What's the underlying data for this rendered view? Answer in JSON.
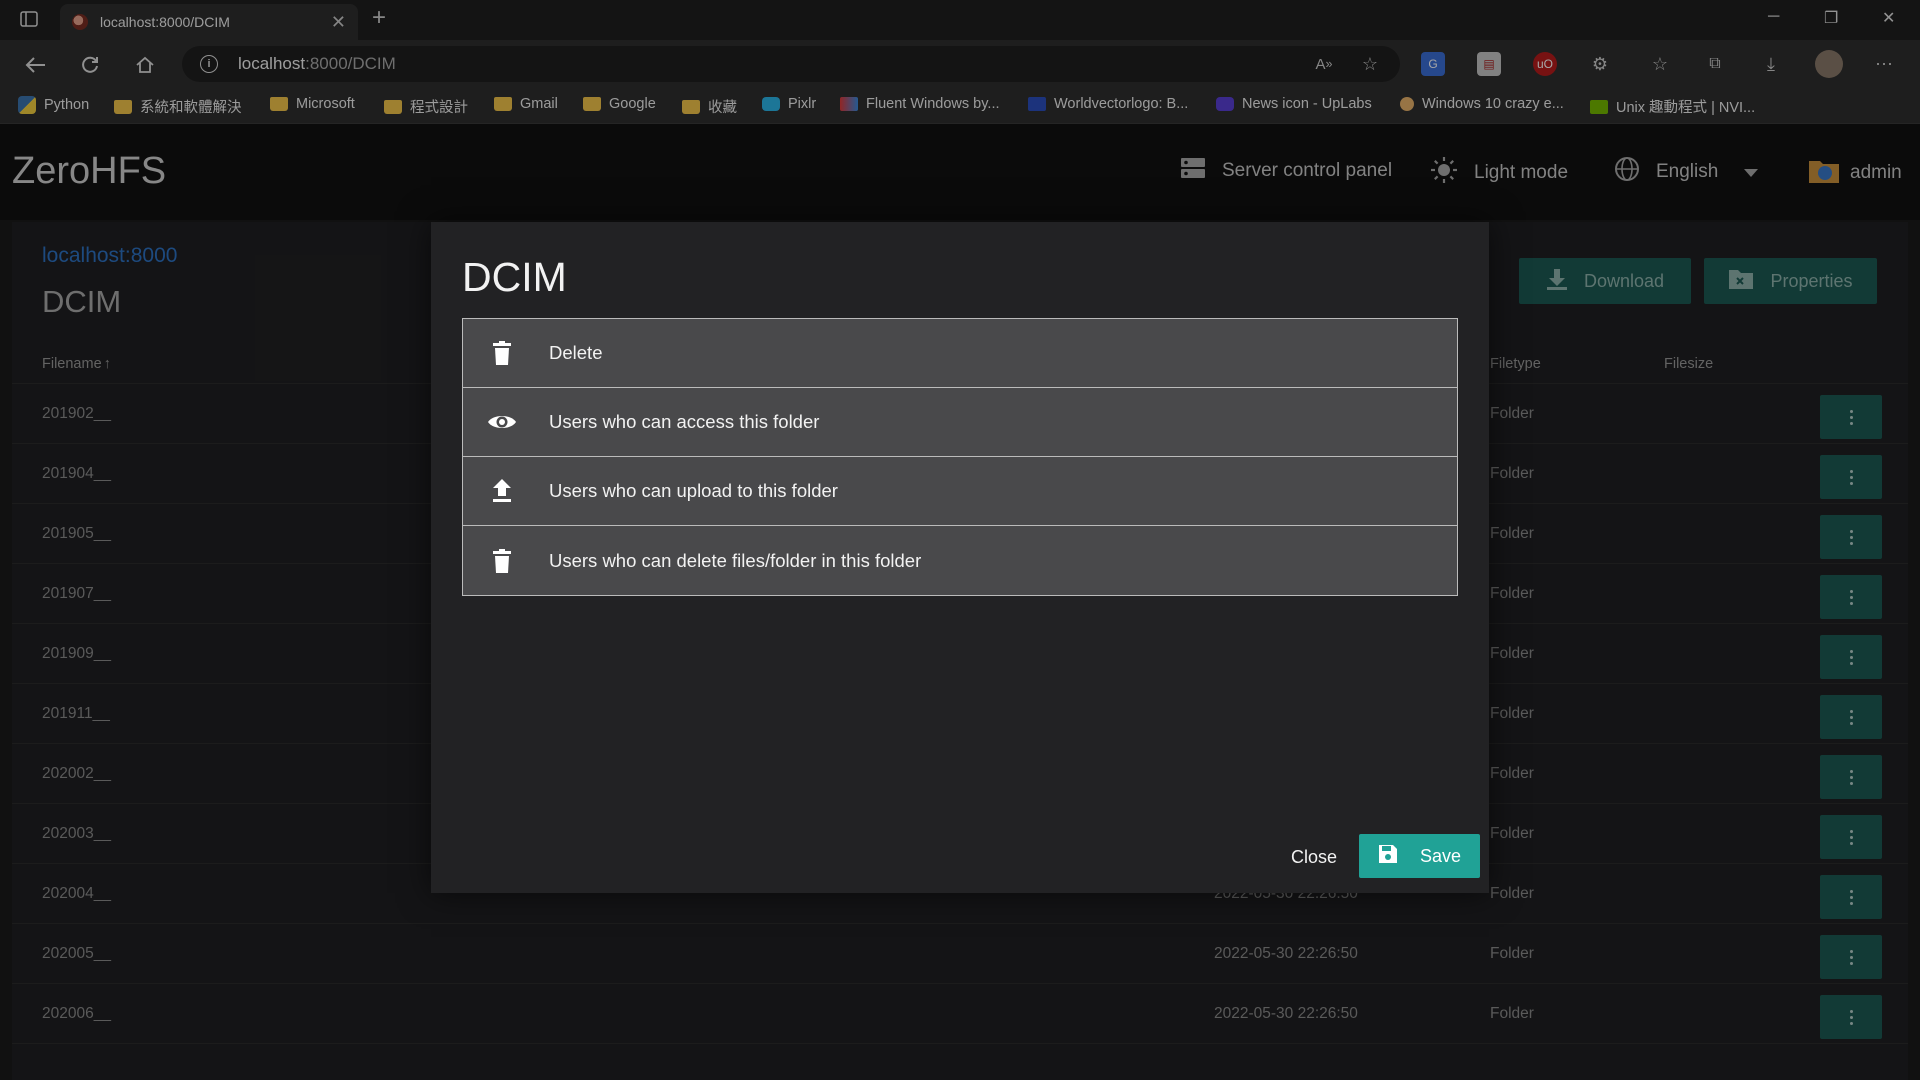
{
  "browser": {
    "tab_title": "localhost:8000/DCIM",
    "new_tab": "+",
    "url_host": "localhost",
    "url_path": ":8000/DCIM",
    "bookmarks": [
      "Python",
      "系統和軟體解決",
      "Microsoft",
      "程式設計",
      "Gmail",
      "Google",
      "收藏",
      "Pixlr",
      "Fluent Windows by...",
      "Worldvectorlogo: B...",
      "News icon - UpLabs",
      "Windows 10 crazy e...",
      "Unix 趣動程式 | NVI..."
    ]
  },
  "app": {
    "brand": "ZeroHFS",
    "header": {
      "server_panel": "Server control panel",
      "light_mode": "Light mode",
      "language": "English",
      "user": "admin"
    },
    "breadcrumb_link": "localhost:8000",
    "folder_title": "DCIM",
    "actions": {
      "download": "Download",
      "properties": "Properties"
    },
    "columns": {
      "filename": "Filename",
      "sort_arrow": "↑",
      "filetype": "Filetype",
      "filesize": "Filesize"
    },
    "rows": [
      {
        "name": "201902__",
        "date": "",
        "type": "Folder"
      },
      {
        "name": "201904__",
        "date": "",
        "type": "Folder"
      },
      {
        "name": "201905__",
        "date": "",
        "type": "Folder"
      },
      {
        "name": "201907__",
        "date": "",
        "type": "Folder"
      },
      {
        "name": "201909__",
        "date": "",
        "type": "Folder"
      },
      {
        "name": "201911__",
        "date": "",
        "type": "Folder"
      },
      {
        "name": "202002__",
        "date": "",
        "type": "Folder"
      },
      {
        "name": "202003__",
        "date": "",
        "type": "Folder"
      },
      {
        "name": "202004__",
        "date": "2022-05-30 22:26:50",
        "type": "Folder"
      },
      {
        "name": "202005__",
        "date": "2022-05-30 22:26:50",
        "type": "Folder"
      },
      {
        "name": "202006__",
        "date": "2022-05-30 22:26:50",
        "type": "Folder"
      }
    ]
  },
  "modal": {
    "title": "DCIM",
    "items": [
      {
        "label": "Delete",
        "icon": "trash-icon"
      },
      {
        "label": "Users who can access this folder",
        "icon": "eye-icon"
      },
      {
        "label": "Users who can upload to this folder",
        "icon": "upload-icon"
      },
      {
        "label": "Users who can delete files/folder in this folder",
        "icon": "trash-icon"
      }
    ],
    "close": "Close",
    "save": "Save"
  },
  "colors": {
    "accent": "#20a296",
    "accent_dim": "#1d5a53",
    "link": "#2d72c4"
  }
}
